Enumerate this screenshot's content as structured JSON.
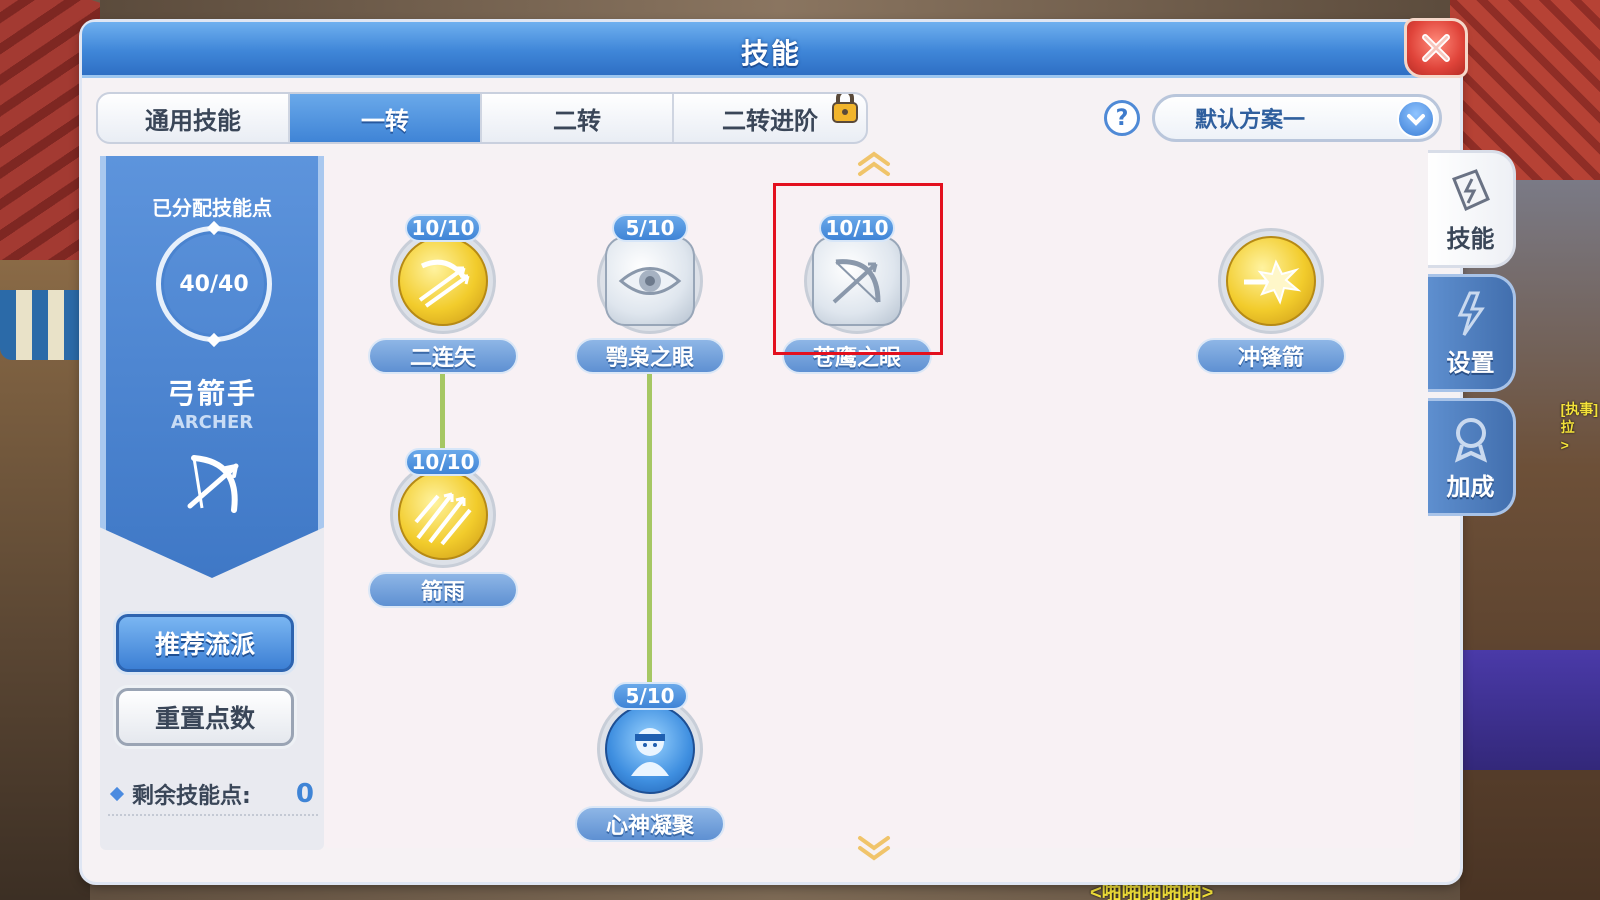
{
  "window": {
    "title": "技能"
  },
  "tabs": [
    {
      "label": "通用技能",
      "active": false,
      "locked": false
    },
    {
      "label": "一转",
      "active": true,
      "locked": false
    },
    {
      "label": "二转",
      "active": false,
      "locked": false
    },
    {
      "label": "二转进阶",
      "active": false,
      "locked": true
    }
  ],
  "help": {
    "label": "?"
  },
  "scheme": {
    "selected": "默认方案一"
  },
  "left_panel": {
    "allocated_label": "已分配技能点",
    "allocated_value": "40/40",
    "class_name": "弓箭手",
    "class_en": "ARCHER",
    "recommend_button": "推荐流派",
    "reset_button": "重置点数",
    "remaining_label": "剩余技能点:",
    "remaining_value": "0"
  },
  "skills": [
    {
      "name": "二连矢",
      "level": "10/10",
      "icon": "double-arrow-icon"
    },
    {
      "name": "鹗枭之眼",
      "level": "5/10",
      "icon": "eye-icon"
    },
    {
      "name": "苍鹰之眼",
      "level": "10/10",
      "icon": "bow-icon"
    },
    {
      "name": "冲锋箭",
      "level": "",
      "icon": "charge-arrow-icon"
    },
    {
      "name": "箭雨",
      "level": "10/10",
      "icon": "arrow-rain-icon"
    },
    {
      "name": "心神凝聚",
      "level": "5/10",
      "icon": "archer-focus-icon"
    }
  ],
  "side_tabs": [
    {
      "label": "技能",
      "active": true
    },
    {
      "label": "设置",
      "active": false
    },
    {
      "label": "加成",
      "active": false
    }
  ],
  "background": {
    "npc_bottom": "<啪啪啪啪啪>",
    "npc_right": "[执事]\n拉\n>"
  },
  "colors": {
    "accent_blue": "#3f84d6",
    "link_green": "#a6c763",
    "highlight_red": "#e3101e",
    "gold": "#f2cc2c"
  }
}
